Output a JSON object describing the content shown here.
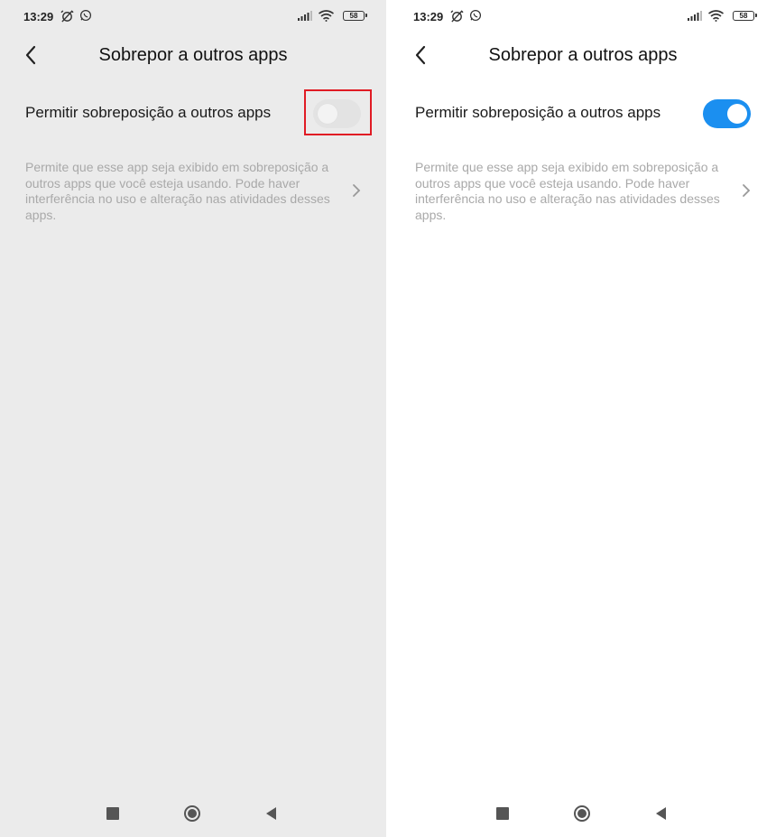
{
  "screens": [
    {
      "status_time": "13:29",
      "battery": "58",
      "title": "Sobrepor a outros apps",
      "setting_label": "Permitir sobreposição a outros apps",
      "toggle_on": false,
      "description": "Permite que esse app seja exibido em sobreposição a outros apps que você esteja usando. Pode haver interferência no uso e alteração nas atividades desses apps."
    },
    {
      "status_time": "13:29",
      "battery": "58",
      "title": "Sobrepor a outros apps",
      "setting_label": "Permitir sobreposição a outros apps",
      "toggle_on": true,
      "description": "Permite que esse app seja exibido em sobreposição a outros apps que você esteja usando. Pode haver interferência no uso e alteração nas atividades desses apps."
    }
  ],
  "icons": {
    "status": [
      "alarm-off-icon",
      "whatsapp-icon",
      "signal-icon",
      "wifi-icon",
      "battery-icon"
    ],
    "nav": [
      "recents-square-icon",
      "home-circle-icon",
      "back-triangle-icon"
    ]
  },
  "colors": {
    "toggle_on": "#1b8ff0",
    "toggle_off": "#e3e3e3",
    "highlight": "#e01b24",
    "left_background": "#ebebeb",
    "right_background": "#ffffff"
  }
}
